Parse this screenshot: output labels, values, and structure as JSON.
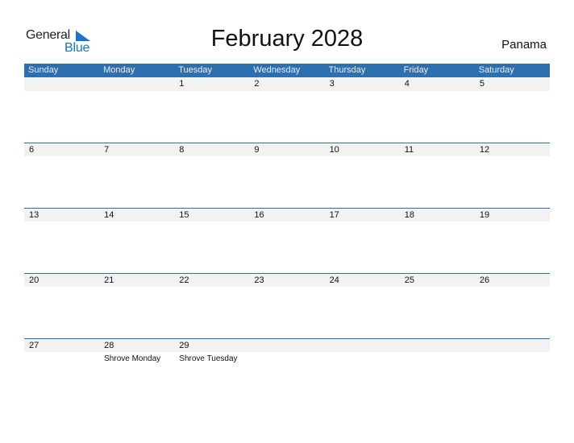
{
  "logo": {
    "text_top": "General",
    "text_bottom": "Blue",
    "brand_color": "#1a73c9"
  },
  "title": "February 2028",
  "country": "Panama",
  "weekdays": [
    "Sunday",
    "Monday",
    "Tuesday",
    "Wednesday",
    "Thursday",
    "Friday",
    "Saturday"
  ],
  "colors": {
    "header_bg": "#2e6fb0",
    "date_strip_bg": "#f2f2f2"
  },
  "weeks": [
    {
      "days": [
        {
          "num": "",
          "event": ""
        },
        {
          "num": "",
          "event": ""
        },
        {
          "num": "1",
          "event": ""
        },
        {
          "num": "2",
          "event": ""
        },
        {
          "num": "3",
          "event": ""
        },
        {
          "num": "4",
          "event": ""
        },
        {
          "num": "5",
          "event": ""
        }
      ]
    },
    {
      "days": [
        {
          "num": "6",
          "event": ""
        },
        {
          "num": "7",
          "event": ""
        },
        {
          "num": "8",
          "event": ""
        },
        {
          "num": "9",
          "event": ""
        },
        {
          "num": "10",
          "event": ""
        },
        {
          "num": "11",
          "event": ""
        },
        {
          "num": "12",
          "event": ""
        }
      ]
    },
    {
      "days": [
        {
          "num": "13",
          "event": ""
        },
        {
          "num": "14",
          "event": ""
        },
        {
          "num": "15",
          "event": ""
        },
        {
          "num": "16",
          "event": ""
        },
        {
          "num": "17",
          "event": ""
        },
        {
          "num": "18",
          "event": ""
        },
        {
          "num": "19",
          "event": ""
        }
      ]
    },
    {
      "days": [
        {
          "num": "20",
          "event": ""
        },
        {
          "num": "21",
          "event": ""
        },
        {
          "num": "22",
          "event": ""
        },
        {
          "num": "23",
          "event": ""
        },
        {
          "num": "24",
          "event": ""
        },
        {
          "num": "25",
          "event": ""
        },
        {
          "num": "26",
          "event": ""
        }
      ]
    },
    {
      "days": [
        {
          "num": "27",
          "event": ""
        },
        {
          "num": "28",
          "event": "Shrove Monday"
        },
        {
          "num": "29",
          "event": "Shrove Tuesday"
        },
        {
          "num": "",
          "event": ""
        },
        {
          "num": "",
          "event": ""
        },
        {
          "num": "",
          "event": ""
        },
        {
          "num": "",
          "event": ""
        }
      ]
    }
  ]
}
